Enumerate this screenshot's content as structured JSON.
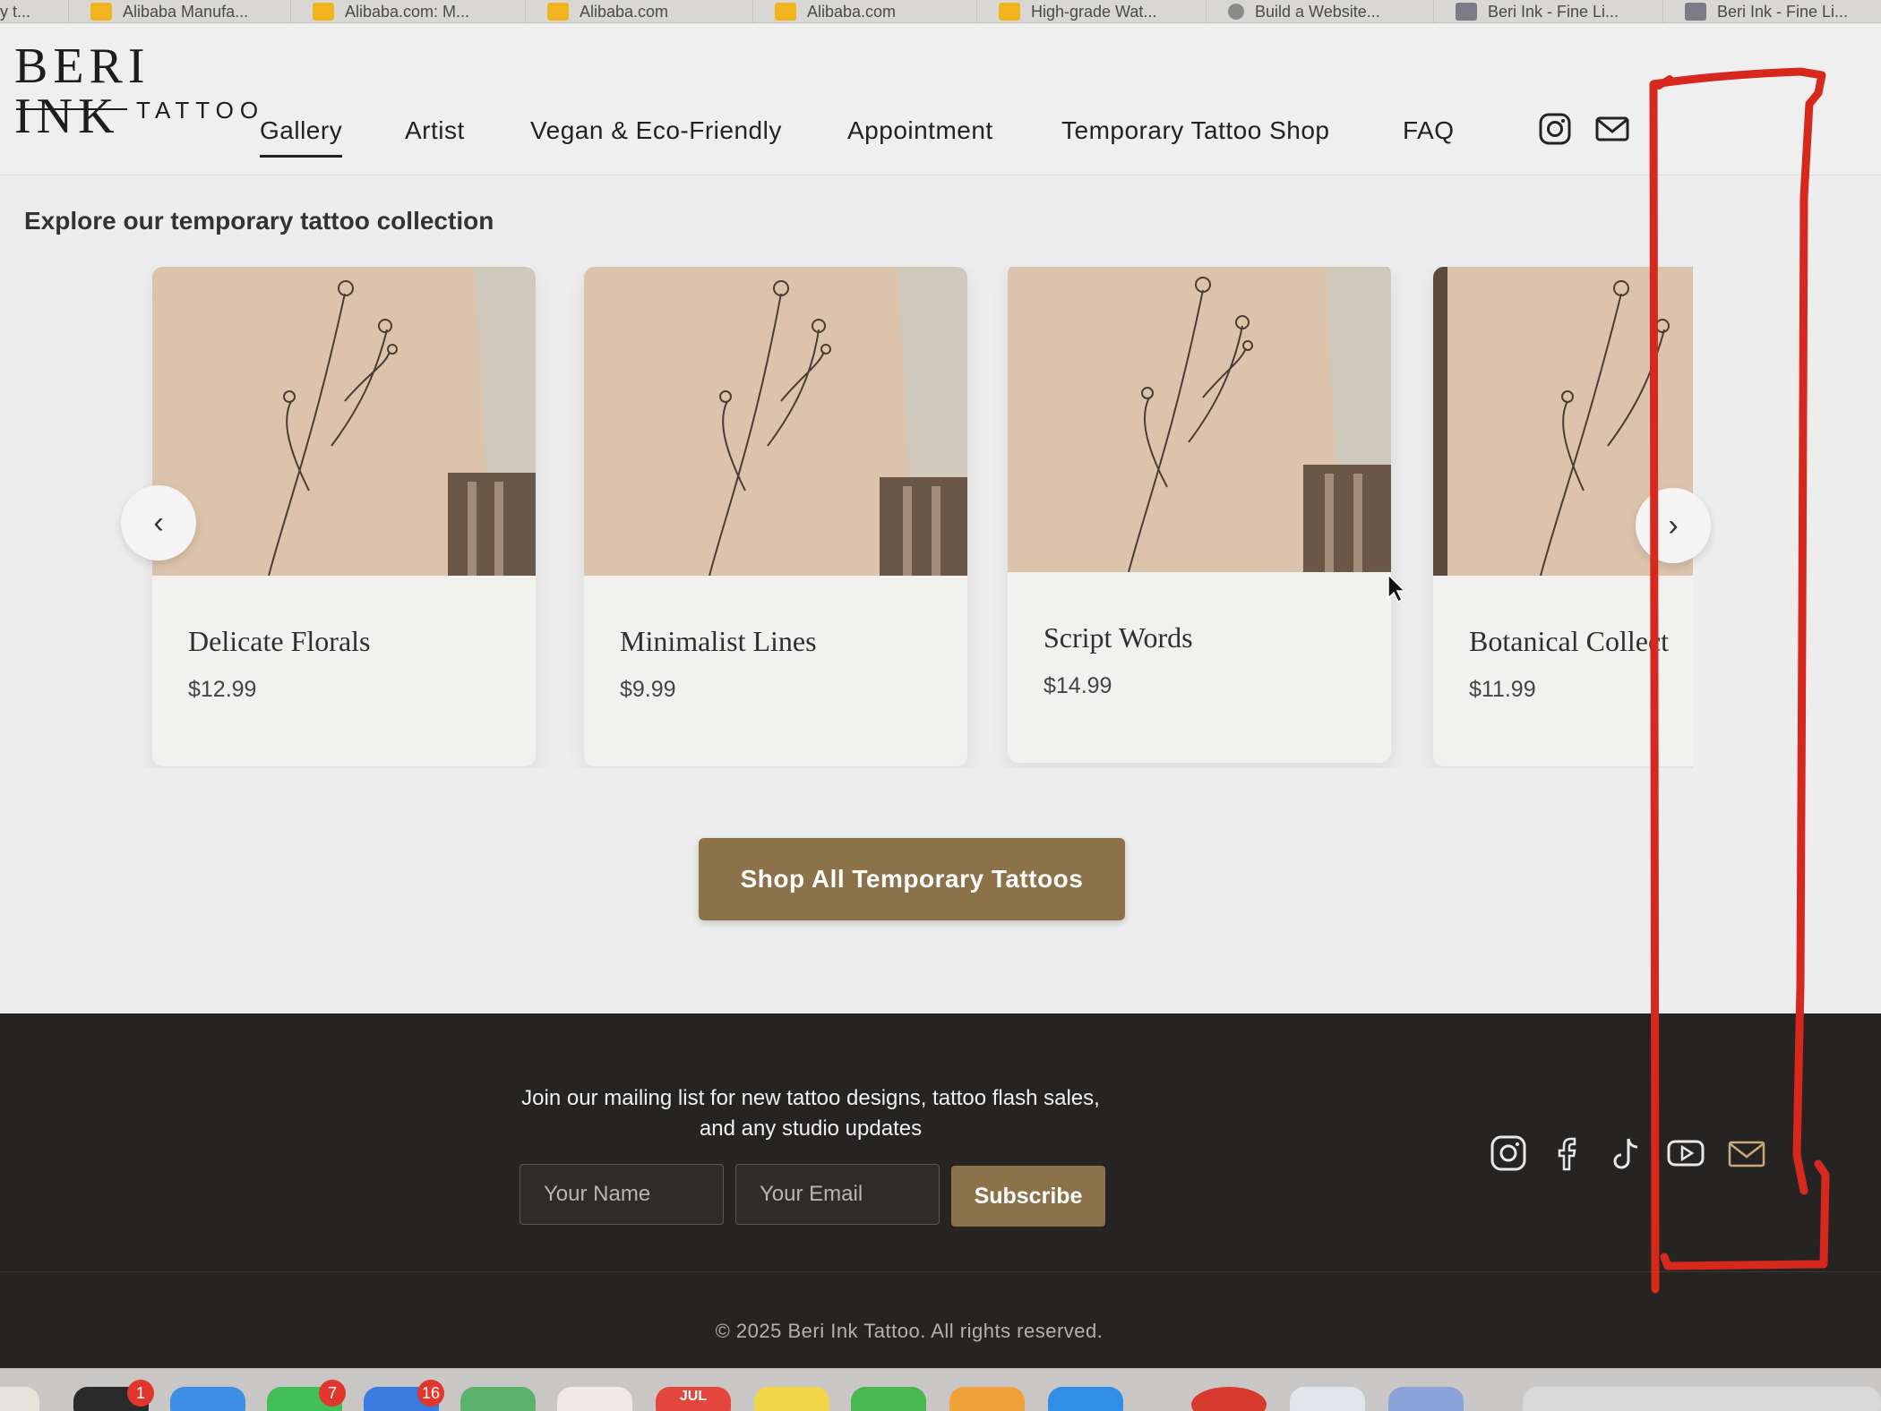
{
  "browser": {
    "tabs": [
      {
        "label": "y t...",
        "icon": "page-icon"
      },
      {
        "label": "Alibaba Manufa...",
        "icon": "alibaba-icon"
      },
      {
        "label": "Alibaba.com: M...",
        "icon": "alibaba-icon"
      },
      {
        "label": "Alibaba.com",
        "icon": "alibaba-icon"
      },
      {
        "label": "Alibaba.com",
        "icon": "alibaba-icon"
      },
      {
        "label": "High-grade Wat...",
        "icon": "alibaba-icon"
      },
      {
        "label": "Build a Website...",
        "icon": "chatbot-icon"
      },
      {
        "label": "Beri Ink - Fine Li...",
        "icon": "m-icon"
      },
      {
        "label": "Beri Ink - Fine Li...",
        "icon": "m-icon"
      }
    ]
  },
  "header": {
    "logo_main": "BERI INK",
    "logo_sub": "TATTOO",
    "nav": [
      {
        "label": "Gallery",
        "active": true
      },
      {
        "label": "Artist"
      },
      {
        "label": "Vegan & Eco-Friendly"
      },
      {
        "label": "Appointment"
      },
      {
        "label": "Temporary Tattoo Shop"
      },
      {
        "label": "FAQ"
      }
    ],
    "icons": [
      "instagram-icon",
      "mail-icon"
    ]
  },
  "main": {
    "heading": "Explore our temporary tattoo collection",
    "products": [
      {
        "title": "Delicate Florals",
        "price": "$12.99"
      },
      {
        "title": "Minimalist Lines",
        "price": "$9.99"
      },
      {
        "title": "Script Words",
        "price": "$14.99"
      },
      {
        "title": "Botanical Collect",
        "price": "$11.99"
      }
    ],
    "prev_arrow": "‹",
    "next_arrow": "›",
    "shop_button": "Shop All Temporary Tattoos"
  },
  "footer": {
    "message": "Join our mailing list for new tattoo designs, tattoo flash sales, and any studio updates",
    "name_placeholder": "Your Name",
    "email_placeholder": "Your Email",
    "subscribe_label": "Subscribe",
    "social": [
      "instagram-icon",
      "facebook-icon",
      "tiktok-icon",
      "youtube-icon",
      "mail-icon"
    ],
    "copyright": "© 2025 Beri Ink Tattoo. All rights reserved."
  },
  "dock": {
    "badges": [
      "1",
      "7",
      "16"
    ],
    "calendar_label": "JUL"
  },
  "colors": {
    "accent": "#8c7249",
    "footer_bg": "#262422",
    "annotation": "#d6281d"
  }
}
